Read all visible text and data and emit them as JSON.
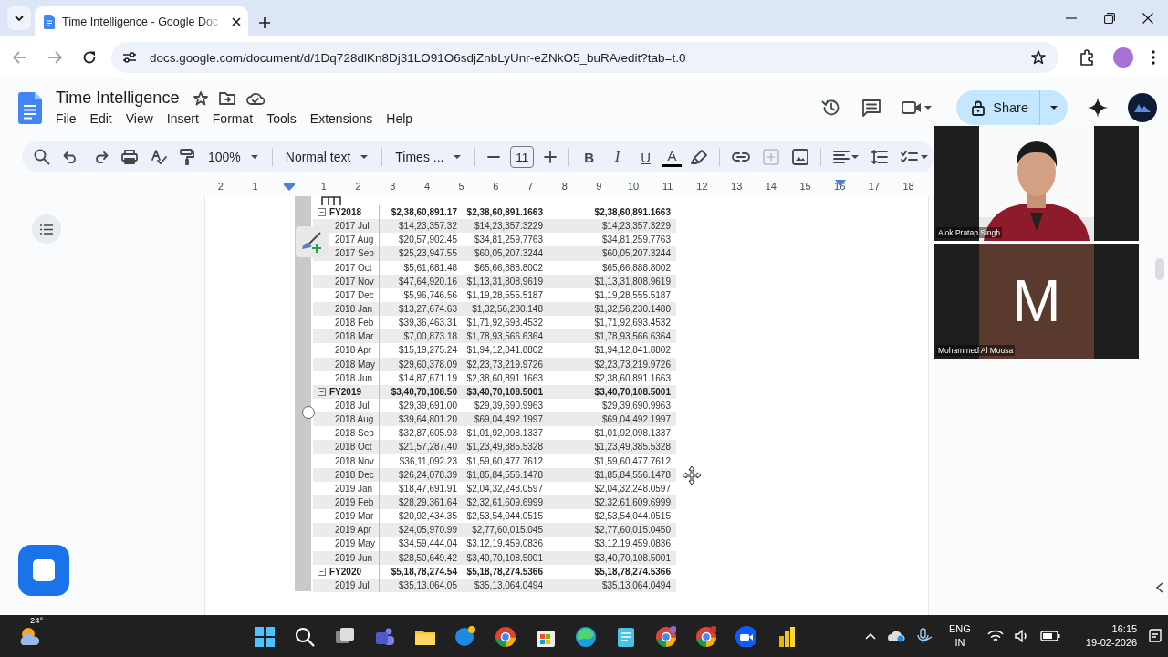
{
  "browser": {
    "tabs": [
      {
        "title": "Time Intelligence - Google Doc",
        "selected": true
      }
    ],
    "url": "docs.google.com/document/d/1Dq728dlKn8Dj31LO91O6sdjZnbLyUnr-eZNkO5_buRA/edit?tab=t.0"
  },
  "doc": {
    "title": "Time Intelligence",
    "menus": [
      "File",
      "Edit",
      "View",
      "Insert",
      "Format",
      "Tools",
      "Extensions",
      "Help"
    ],
    "share": "Share"
  },
  "toolbar": {
    "zoom": "100%",
    "style": "Normal text",
    "font": "Times ...",
    "size": "11",
    "bold": "B",
    "italic": "I",
    "underline": "U",
    "text_color": "A"
  },
  "ruler": [
    "2",
    "1",
    "1",
    "2",
    "3",
    "4",
    "5",
    "6",
    "7",
    "8",
    "9",
    "10",
    "11",
    "12",
    "13",
    "14",
    "15",
    "16",
    "17",
    "18"
  ],
  "table": {
    "rows": [
      {
        "kind": "group",
        "expanded": true,
        "label": "FY2018",
        "values": [
          "$2,38,60,891.17",
          "$2,38,60,891.1663",
          "$2,38,60,891.1663"
        ]
      },
      {
        "kind": "month",
        "label": "2017 Jul",
        "values": [
          "$14,23,357.32",
          "$14,23,357.3229",
          "$14,23,357.3229"
        ]
      },
      {
        "kind": "month",
        "label": "2017 Aug",
        "values": [
          "$20,57,902.45",
          "$34,81,259.7763",
          "$34,81,259.7763"
        ]
      },
      {
        "kind": "month",
        "label": "2017 Sep",
        "values": [
          "$25,23,947.55",
          "$60,05,207.3244",
          "$60,05,207.3244"
        ]
      },
      {
        "kind": "month",
        "label": "2017 Oct",
        "values": [
          "$5,61,681.48",
          "$65,66,888.8002",
          "$65,66,888.8002"
        ]
      },
      {
        "kind": "month",
        "label": "2017 Nov",
        "values": [
          "$47,64,920.16",
          "$1,13,31,808.9619",
          "$1,13,31,808.9619"
        ]
      },
      {
        "kind": "month",
        "label": "2017 Dec",
        "values": [
          "$5,96,746.56",
          "$1,19,28,555.5187",
          "$1,19,28,555.5187"
        ]
      },
      {
        "kind": "month",
        "label": "2018 Jan",
        "values": [
          "$13,27,674.63",
          "$1,32,56,230.148",
          "$1,32,56,230.1480"
        ]
      },
      {
        "kind": "month",
        "label": "2018 Feb",
        "values": [
          "$39,36,463.31",
          "$1,71,92,693.4532",
          "$1,71,92,693.4532"
        ]
      },
      {
        "kind": "month",
        "label": "2018 Mar",
        "values": [
          "$7,00,873.18",
          "$1,78,93,566.6364",
          "$1,78,93,566.6364"
        ]
      },
      {
        "kind": "month",
        "label": "2018 Apr",
        "values": [
          "$15,19,275.24",
          "$1,94,12,841.8802",
          "$1,94,12,841.8802"
        ]
      },
      {
        "kind": "month",
        "label": "2018 May",
        "values": [
          "$29,60,378.09",
          "$2,23,73,219.9726",
          "$2,23,73,219.9726"
        ]
      },
      {
        "kind": "month",
        "label": "2018 Jun",
        "values": [
          "$14,87,671.19",
          "$2,38,60,891.1663",
          "$2,38,60,891.1663"
        ]
      },
      {
        "kind": "group",
        "expanded": true,
        "label": "FY2019",
        "values": [
          "$3,40,70,108.50",
          "$3,40,70,108.5001",
          "$3,40,70,108.5001"
        ]
      },
      {
        "kind": "month",
        "label": "2018 Jul",
        "values": [
          "$29,39,691.00",
          "$29,39,690.9963",
          "$29,39,690.9963"
        ]
      },
      {
        "kind": "month",
        "label": "2018 Aug",
        "values": [
          "$39,64,801.20",
          "$69,04,492.1997",
          "$69,04,492.1997"
        ]
      },
      {
        "kind": "month",
        "label": "2018 Sep",
        "values": [
          "$32,87,605.93",
          "$1,01,92,098.1337",
          "$1,01,92,098.1337"
        ]
      },
      {
        "kind": "month",
        "label": "2018 Oct",
        "values": [
          "$21,57,287.40",
          "$1,23,49,385.5328",
          "$1,23,49,385.5328"
        ]
      },
      {
        "kind": "month",
        "label": "2018 Nov",
        "values": [
          "$36,11,092.23",
          "$1,59,60,477.7612",
          "$1,59,60,477.7612"
        ]
      },
      {
        "kind": "month",
        "label": "2018 Dec",
        "values": [
          "$26,24,078.39",
          "$1,85,84,556.1478",
          "$1,85,84,556.1478"
        ]
      },
      {
        "kind": "month",
        "label": "2019 Jan",
        "values": [
          "$18,47,691.91",
          "$2,04,32,248.0597",
          "$2,04,32,248.0597"
        ]
      },
      {
        "kind": "month",
        "label": "2019 Feb",
        "values": [
          "$28,29,361.64",
          "$2,32,61,609.6999",
          "$2,32,61,609.6999"
        ]
      },
      {
        "kind": "month",
        "label": "2019 Mar",
        "values": [
          "$20,92,434.35",
          "$2,53,54,044.0515",
          "$2,53,54,044.0515"
        ]
      },
      {
        "kind": "month",
        "label": "2019 Apr",
        "values": [
          "$24,05,970.99",
          "$2,77,60,015.045",
          "$2,77,60,015.0450"
        ]
      },
      {
        "kind": "month",
        "label": "2019 May",
        "values": [
          "$34,59,444.04",
          "$3,12,19,459.0836",
          "$3,12,19,459.0836"
        ]
      },
      {
        "kind": "month",
        "label": "2019 Jun",
        "values": [
          "$28,50,649.42",
          "$3,40,70,108.5001",
          "$3,40,70,108.5001"
        ]
      },
      {
        "kind": "group",
        "expanded": true,
        "label": "FY2020",
        "values": [
          "$5,18,78,274.54",
          "$5,18,78,274.5366",
          "$5,18,78,274.5366"
        ]
      },
      {
        "kind": "month",
        "label": "2019 Jul",
        "values": [
          "$35,13,064.05",
          "$35,13,064.0494",
          "$35,13,064.0494"
        ]
      }
    ]
  },
  "video": {
    "participants": [
      {
        "kind": "camera",
        "name": "Alok Pratap Singh"
      },
      {
        "kind": "initial",
        "initial": "M",
        "name": "Mohammed Al Mousa"
      }
    ]
  },
  "taskbar": {
    "weather": "24°",
    "language": [
      "ENG",
      "IN"
    ],
    "time": "16:15",
    "date": "19-02-2026"
  }
}
